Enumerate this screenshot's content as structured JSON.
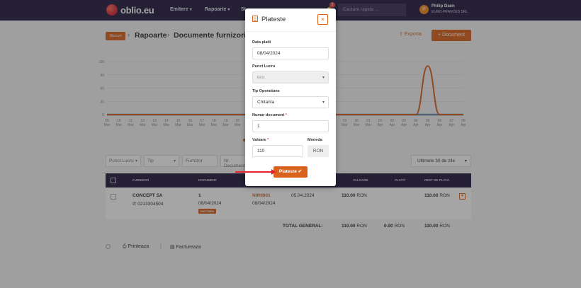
{
  "brand": {
    "logo_text": "oblio.eu",
    "accent": "#d9621e",
    "nav_bg": "#231b3e"
  },
  "nav": {
    "items": [
      "Emitere",
      "Rapoarte",
      "St"
    ],
    "notification_count": "3",
    "search_placeholder": "Cautare rapida ...",
    "user_initial": "P",
    "user_name": "Philip Daen",
    "user_company": "EURO-FRANCES SRL"
  },
  "page": {
    "back_label": "Stocuri",
    "breadcrumb": [
      "Rapoarte",
      "Documente furnizori"
    ],
    "export_label": "Exporta",
    "new_document_label": "Document"
  },
  "chart_data": {
    "type": "line",
    "x": [
      "09 Mar",
      "10 Mar",
      "11 Mar",
      "12 Mar",
      "13 Mar",
      "14 Mar",
      "15 Mar",
      "16 Mar",
      "17 Mar",
      "18 Mar",
      "19 Mar",
      "20 Mar",
      "21 Mar",
      "22 Mar",
      "23 Mar",
      "24 Mar",
      "25 Mar",
      "26 Mar",
      "27 Mar",
      "28 Mar",
      "29 Mar",
      "30 Mar",
      "31 Mar",
      "01 Apr",
      "02 Apr",
      "03 Apr",
      "04 Apr",
      "05 Apr",
      "06 Apr",
      "07 Apr",
      "08 Apr"
    ],
    "series": [
      {
        "values": [
          0,
          0,
          0,
          0,
          0,
          0,
          0,
          0,
          0,
          0,
          0,
          0,
          0,
          0,
          0,
          0,
          0,
          0,
          0,
          0,
          0,
          0,
          0,
          0,
          0,
          0,
          0,
          0,
          0,
          0,
          0
        ],
        "color": "#6b8fb0"
      },
      {
        "values": [
          0,
          0,
          0,
          0,
          0,
          0,
          0,
          0,
          0,
          0,
          0,
          0,
          0,
          0,
          0,
          0,
          0,
          0,
          0,
          0,
          0,
          0,
          0,
          0,
          0,
          0,
          0,
          110,
          0,
          0,
          0
        ],
        "color": "#d9621e"
      }
    ],
    "yticks": [
      0,
      30,
      60,
      90,
      120
    ],
    "ylim": [
      0,
      120
    ],
    "grid": true
  },
  "filters": {
    "punct_lucru": "Punct Lucru",
    "tip": "Tip",
    "furnizor": "Furnizor",
    "nr_document": "Nr. Document",
    "period": "Ultimele 30 de zile"
  },
  "table": {
    "headers": [
      "FURNIZOR",
      "DOCUMENT",
      "SCADENTA",
      "VALOARE",
      "PLATIT",
      "REST DE PLATA"
    ],
    "rows": [
      {
        "supplier": "CONCEPT SA",
        "phone": "0213304504",
        "doc_number": "1",
        "doc_date": "08/04/2024",
        "doc_badge": "FACTURA",
        "nir": "NIR0001",
        "nir_date": "08/04/2024",
        "due_date": "05.04.2024",
        "value": "110.00",
        "currency": "RON",
        "rest": "110.00"
      }
    ],
    "total_label": "TOTAL GENERAL:",
    "total_value": "110.00",
    "total_paid": "0.00",
    "total_rest": "110.00"
  },
  "footer": {
    "print_label": "Printeaza",
    "invoice_label": "Factureaza"
  },
  "modal": {
    "title": "Plateste",
    "close_symbol": "×",
    "fields": {
      "date_label": "Data platii",
      "date_value": "08/04/2024",
      "workpoint_label": "Punct Lucru",
      "workpoint_value": "test",
      "optype_label": "Tip Operatiune",
      "optype_value": "Chitanta",
      "docnum_label": "Numar document",
      "docnum_value": "1",
      "amount_label": "Valoare",
      "amount_value": "110",
      "currency_label": "Moneda",
      "currency_value": "RON"
    },
    "submit_label": "Plateste"
  }
}
